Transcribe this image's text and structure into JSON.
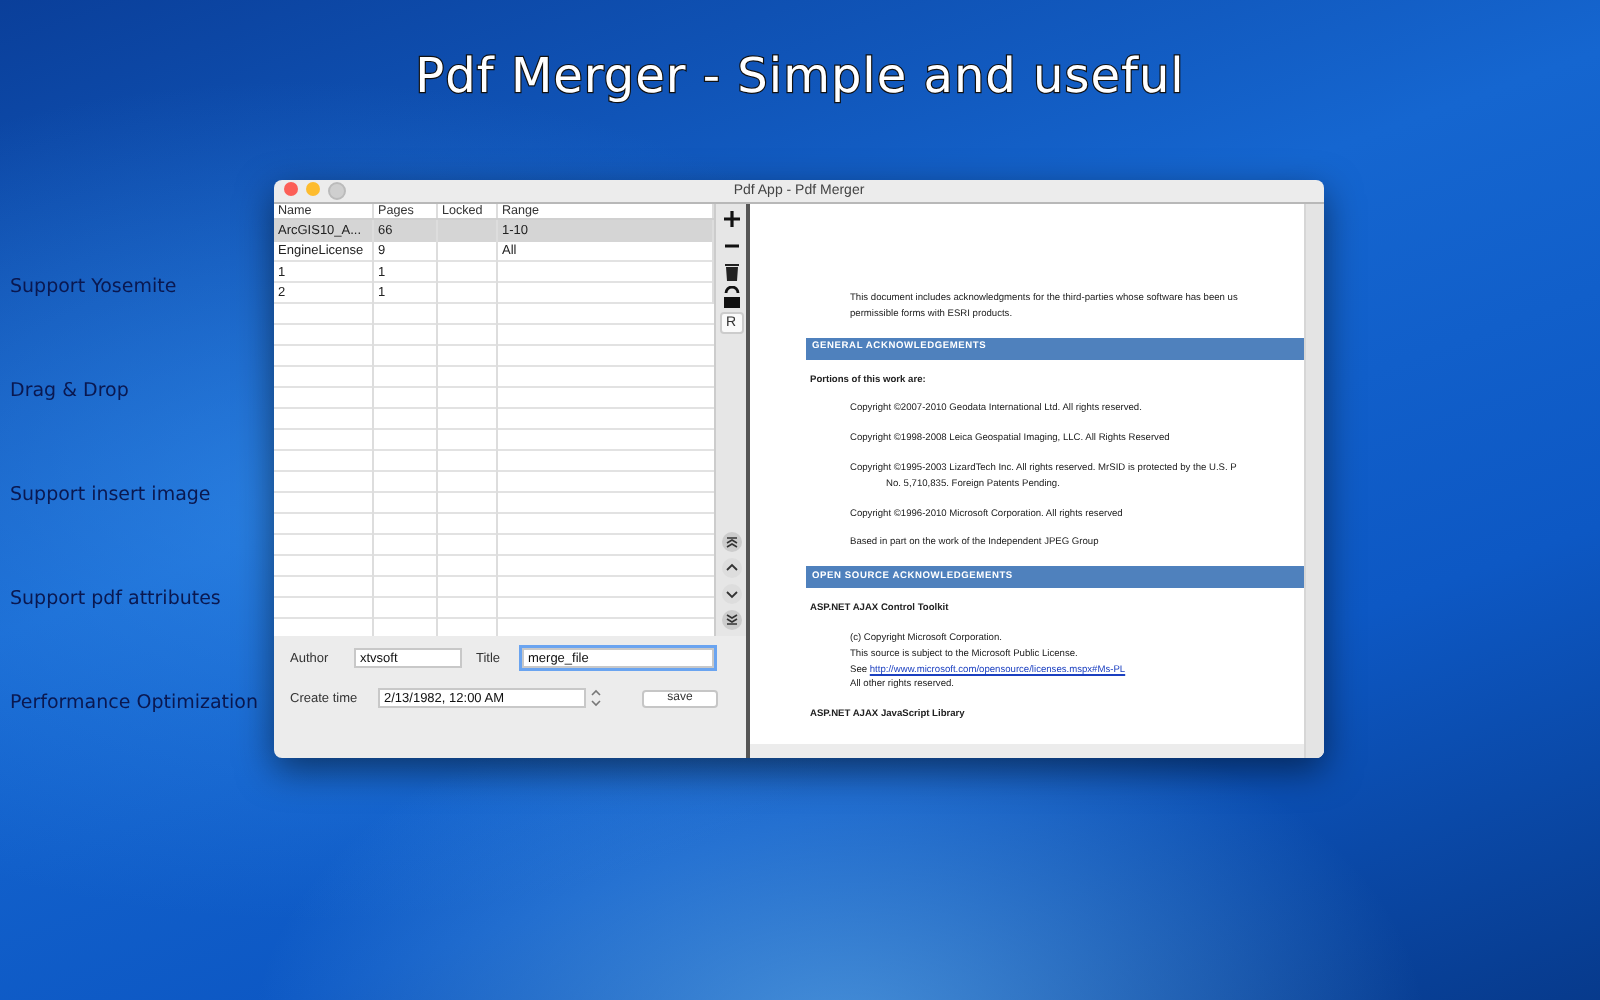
{
  "headline": "Pdf Merger - Simple and useful",
  "features": [
    "Support Yosemite",
    "Drag & Drop",
    "Support  insert image",
    "Support pdf attributes",
    "Performance Optimization"
  ],
  "window": {
    "title": "Pdf App - Pdf Merger",
    "lights": [
      {
        "kind": "close",
        "enabled": true
      },
      {
        "kind": "minimize",
        "enabled": true
      },
      {
        "kind": "zoom",
        "enabled": false
      }
    ]
  },
  "table": {
    "columns": [
      "Name",
      "Pages",
      "Locked",
      "Range"
    ],
    "rows": [
      {
        "name": "ArcGIS10_A...",
        "pages": "66",
        "range": "1-10",
        "selected": true
      },
      {
        "name": "EngineLicense",
        "pages": "9",
        "range": "All",
        "selected": false
      },
      {
        "name": "1",
        "pages": "1",
        "selected": false
      },
      {
        "name": "2",
        "pages": "1",
        "selected": false
      }
    ]
  },
  "toolbar": {
    "tools": [
      {
        "kind": "add"
      },
      {
        "kind": "remove"
      },
      {
        "kind": "trash"
      },
      {
        "kind": "unlock"
      },
      {
        "kind": "text",
        "label": "R"
      }
    ],
    "movers": [
      {
        "kind": "top"
      },
      {
        "kind": "up"
      },
      {
        "kind": "down"
      },
      {
        "kind": "bottom"
      }
    ]
  },
  "form": {
    "author": {
      "label": "Author",
      "value": "xtvsoft"
    },
    "title": {
      "label": "Title",
      "value": "merge_file",
      "focused": true
    },
    "create_time": {
      "label": "Create time",
      "value": "2/13/1982, 12:00 AM"
    },
    "save_button": "save"
  },
  "preview": {
    "blocks": [
      {
        "kind": "para",
        "lines": [
          {
            "text": "This document includes acknowledgments for the third-parties whose software has been us"
          },
          {
            "text": "permissible forms with ESRI products."
          }
        ]
      },
      {
        "kind": "banner",
        "lines": [
          {
            "text": "GENERAL ACKNOWLEDGEMENTS"
          }
        ]
      },
      {
        "kind": "bold",
        "lines": [
          {
            "text": "Portions of this work are:"
          }
        ]
      },
      {
        "kind": "para",
        "lines": [
          {
            "text": "Copyright ©2007-2010 Geodata International Ltd. All rights reserved."
          }
        ]
      },
      {
        "kind": "para",
        "lines": [
          {
            "text": "Copyright ©1998-2008 Leica Geospatial Imaging, LLC. All Rights Reserved"
          }
        ]
      },
      {
        "kind": "hanging",
        "lines": [
          {
            "text": "Copyright ©1995-2003 LizardTech Inc.  All rights reserved.  MrSID is protected by the U.S. P"
          },
          {
            "text": "No. 5,710,835. Foreign Patents Pending."
          }
        ]
      },
      {
        "kind": "para",
        "lines": [
          {
            "text": "Copyright ©1996-2010 Microsoft Corporation. All rights reserved"
          }
        ]
      },
      {
        "kind": "para",
        "lines": [
          {
            "text": "Based in part on the work of the Independent JPEG Group"
          }
        ]
      },
      {
        "kind": "banner",
        "lines": [
          {
            "text": "OPEN SOURCE ACKNOWLEDGEMENTS"
          }
        ]
      },
      {
        "kind": "bold",
        "lines": [
          {
            "text": "ASP.NET AJAX Control Toolkit"
          }
        ]
      },
      {
        "kind": "para",
        "lines": [
          {
            "text": "(c) Copyright Microsoft Corporation."
          },
          {
            "text": "This source is subject to the Microsoft Public License."
          },
          {
            "prefix": "See",
            "link": "http://www.microsoft.com/opensource/licenses.mspx#Ms-PL"
          },
          {
            "text": "All other rights reserved."
          }
        ]
      },
      {
        "kind": "bold",
        "lines": [
          {
            "text": "ASP.NET AJAX JavaScript Library"
          }
        ]
      }
    ]
  }
}
